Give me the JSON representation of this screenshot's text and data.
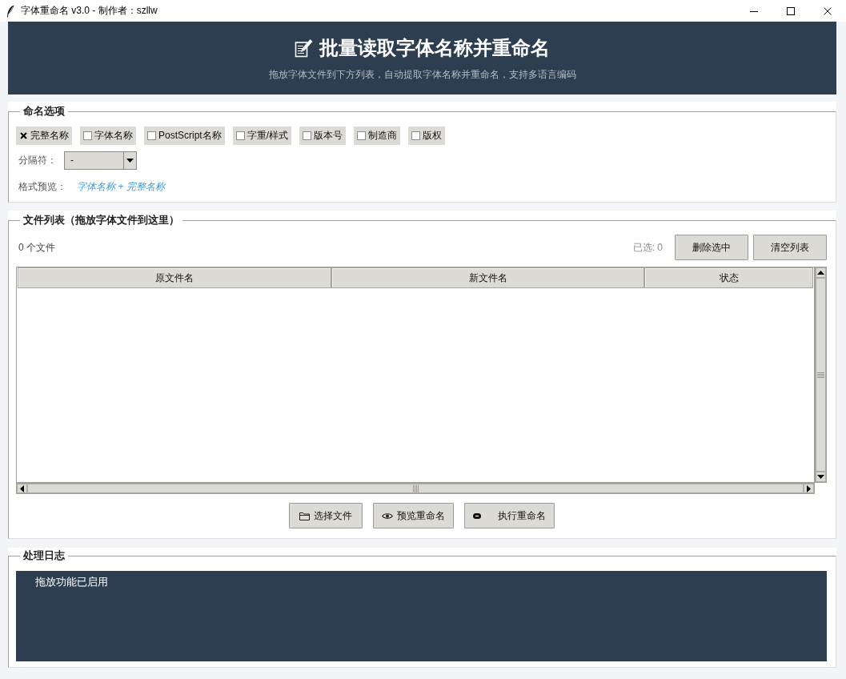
{
  "window": {
    "title": "字体重命名 v3.0 - 制作者：szllw"
  },
  "header": {
    "title": "批量读取字体名称并重命名",
    "subtitle": "拖放字体文件到下方列表，自动提取字体名称并重命名，支持多语言编码"
  },
  "naming_options": {
    "title": "命名选项",
    "checkboxes": [
      {
        "label": "完整名称",
        "checked": true
      },
      {
        "label": "字体名称",
        "checked": false
      },
      {
        "label": "PostScript名称",
        "checked": false
      },
      {
        "label": "字重/样式",
        "checked": false
      },
      {
        "label": "版本号",
        "checked": false
      },
      {
        "label": "制造商",
        "checked": false
      },
      {
        "label": "版权",
        "checked": false
      }
    ],
    "separator": {
      "label": "分隔符：",
      "value": "-"
    },
    "format_preview": {
      "label": "格式预览：",
      "value": "字体名称 + 完整名称"
    }
  },
  "file_list": {
    "title": "文件列表（拖放字体文件到这里）",
    "count": "0 个文件",
    "selected_count": "已选: 0",
    "buttons": [
      {
        "label": "删除选中"
      },
      {
        "label": "清空列表"
      }
    ],
    "table": {
      "columns": [
        "原文件名",
        "新文件名",
        "状态"
      ]
    },
    "actions": [
      {
        "label": "选择文件"
      },
      {
        "label": "预览重命名"
      },
      {
        "label": "执行重命名"
      }
    ]
  },
  "log": {
    "title": "处理日志",
    "lines": [
      "拖放功能已启用"
    ]
  }
}
